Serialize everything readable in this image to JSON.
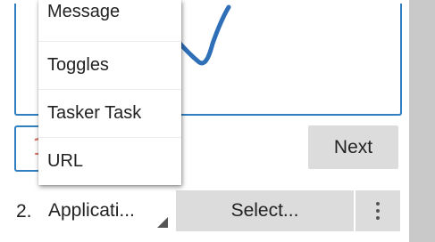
{
  "menu": {
    "items": [
      {
        "label": "Message"
      },
      {
        "label": "Toggles"
      },
      {
        "label": "Tasker Task"
      },
      {
        "label": "URL"
      }
    ]
  },
  "form": {
    "text_value": "1",
    "next_label": "Next",
    "row_number": "2.",
    "action_type": "Applicati...",
    "select_label": "Select..."
  },
  "icons": {
    "overflow": "more-vertical-icon",
    "dropdown": "dropdown-triangle-icon"
  },
  "colors": {
    "accent": "#2f7fc1",
    "stroke": "#2f6fb8",
    "button_bg": "#dcdcdc"
  }
}
